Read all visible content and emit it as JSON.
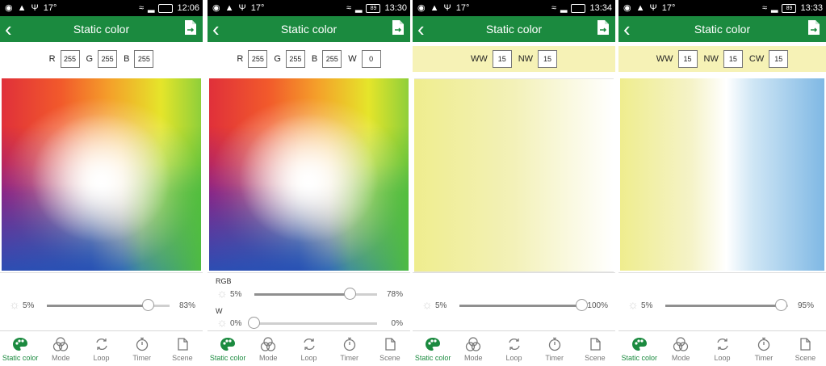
{
  "colors": {
    "accent": "#1b8a3f",
    "status_bar": "#000000"
  },
  "tabs": [
    {
      "label": "Static color",
      "icon": "palette-icon"
    },
    {
      "label": "Mode",
      "icon": "circles-icon"
    },
    {
      "label": "Loop",
      "icon": "loop-icon"
    },
    {
      "label": "Timer",
      "icon": "timer-icon"
    },
    {
      "label": "Scene",
      "icon": "scene-icon"
    }
  ],
  "screens": [
    {
      "status": {
        "temp": "17°",
        "time": "12:06",
        "battery": ""
      },
      "title": "Static color",
      "values": [
        {
          "label": "R",
          "value": "255"
        },
        {
          "label": "G",
          "value": "255"
        },
        {
          "label": "B",
          "value": "255"
        }
      ],
      "sliders": [
        {
          "label": "",
          "min": "5%",
          "max": "83%",
          "level": 0.83
        }
      ]
    },
    {
      "status": {
        "temp": "17°",
        "time": "13:30",
        "battery": "89"
      },
      "title": "Static color",
      "values": [
        {
          "label": "R",
          "value": "255"
        },
        {
          "label": "G",
          "value": "255"
        },
        {
          "label": "B",
          "value": "255"
        },
        {
          "label": "W",
          "value": "0"
        }
      ],
      "sliders": [
        {
          "label": "RGB",
          "min": "5%",
          "max": "78%",
          "level": 0.78
        },
        {
          "label": "W",
          "min": "0%",
          "max": "0%",
          "level": 0.0
        }
      ]
    },
    {
      "status": {
        "temp": "17°",
        "time": "13:34",
        "battery": ""
      },
      "title": "Static color",
      "values": [
        {
          "label": "WW",
          "value": "15"
        },
        {
          "label": "NW",
          "value": "15"
        }
      ],
      "sliders": [
        {
          "label": "",
          "min": "5%",
          "max": "100%",
          "level": 1.0
        }
      ]
    },
    {
      "status": {
        "temp": "17°",
        "time": "13:33",
        "battery": "89"
      },
      "title": "Static color",
      "values": [
        {
          "label": "WW",
          "value": "15"
        },
        {
          "label": "NW",
          "value": "15"
        },
        {
          "label": "CW",
          "value": "15"
        }
      ],
      "sliders": [
        {
          "label": "",
          "min": "5%",
          "max": "95%",
          "level": 0.95
        }
      ]
    }
  ]
}
